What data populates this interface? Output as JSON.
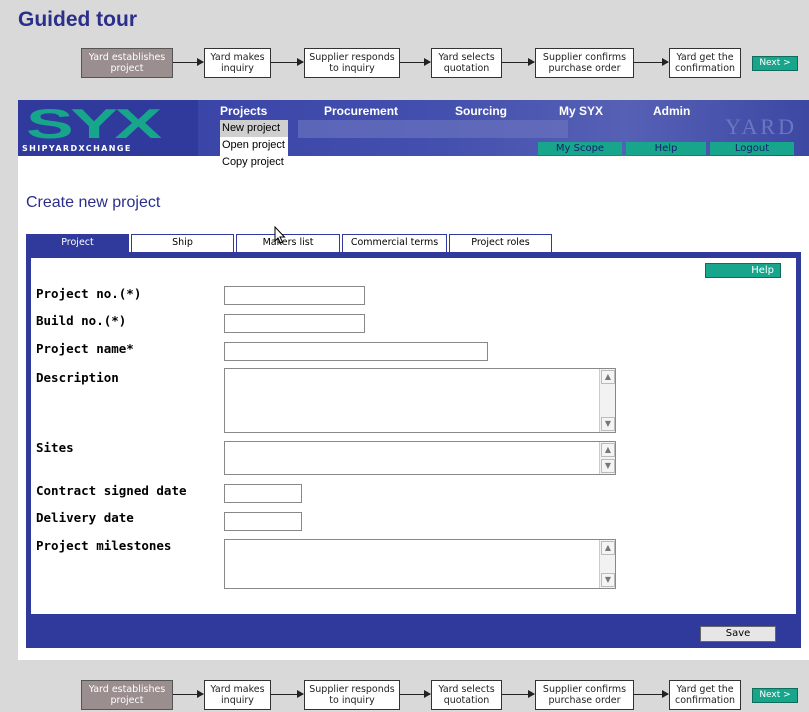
{
  "tour_title": "Guided tour",
  "flow": {
    "steps": [
      {
        "label": "Yard establishes project"
      },
      {
        "label": "Yard makes inquiry"
      },
      {
        "label": "Supplier responds to inquiry"
      },
      {
        "label": "Yard selects quotation"
      },
      {
        "label": "Supplier confirms purchase order"
      },
      {
        "label": "Yard get the confirmation"
      }
    ],
    "next_label": "Next >"
  },
  "banner": {
    "logo_text": "SYX",
    "logo_sub": "SHIPYARDXCHANGE",
    "yard_text": "YARD",
    "menu": [
      "Projects",
      "Procurement",
      "Sourcing",
      "My SYX",
      "Admin"
    ],
    "subbar": [
      "My Scope",
      "Help",
      "Logout"
    ]
  },
  "dropdown": [
    "New project",
    "Open project",
    "Copy project"
  ],
  "page_title": "Create new project",
  "tabs": [
    "Project",
    "Ship",
    "Makers list",
    "Commercial terms",
    "Project roles"
  ],
  "form": {
    "help_label": "Help",
    "fields": {
      "project_no": {
        "label": "Project no.(*)",
        "value": ""
      },
      "build_no": {
        "label": "Build no.(*)",
        "value": ""
      },
      "project_name": {
        "label": "Project name*",
        "value": ""
      },
      "description": {
        "label": "Description",
        "value": ""
      },
      "sites": {
        "label": "Sites",
        "value": ""
      },
      "contract_signed_date": {
        "label": "Contract signed date",
        "value": ""
      },
      "delivery_date": {
        "label": "Delivery date",
        "value": ""
      },
      "project_milestones": {
        "label": "Project milestones",
        "value": ""
      }
    },
    "save_label": "Save"
  },
  "colors": {
    "brand_blue": "#2f3a9c",
    "brand_teal": "#17a68c",
    "title_blue": "#2b2f8a",
    "active_step": "#9b8e8e"
  }
}
